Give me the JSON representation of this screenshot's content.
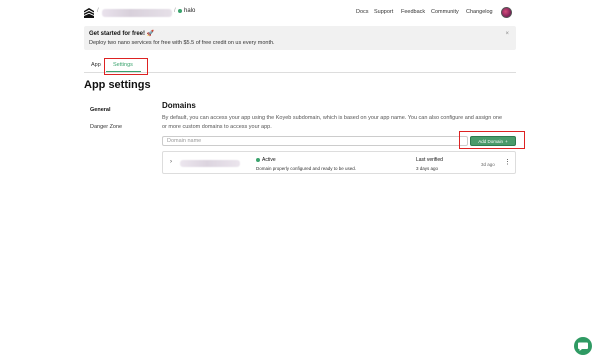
{
  "header": {
    "separator": "/",
    "app_name": "halo",
    "nav": [
      "Docs",
      "Support",
      "Feedback",
      "Community",
      "Changelog"
    ]
  },
  "banner": {
    "title": "Get started for free! 🚀",
    "text": "Deploy two nano services for free with $5.5 of free credit on us every month.",
    "close": "×"
  },
  "tabs": [
    "App",
    "Settings"
  ],
  "page_title": "App settings",
  "sidebar": [
    "General",
    "Danger Zone"
  ],
  "domains": {
    "title": "Domains",
    "description": "By default, you can access your app using the Koyeb subdomain, which is based on your app name. You can also configure and assign one or more custom domains to access your app.",
    "input_placeholder": "Domain name",
    "add_button": "Add Domain",
    "add_icon": "+",
    "rows": [
      {
        "status": "Active",
        "status_text": "Domain properly configured and ready to be used.",
        "last_verified_label": "Last verified",
        "last_verified_value": "3 days ago",
        "age": "3d ago"
      }
    ]
  },
  "colors": {
    "accent": "#3aa36d",
    "button": "#4a9a6a",
    "highlight": "#dd2222"
  }
}
